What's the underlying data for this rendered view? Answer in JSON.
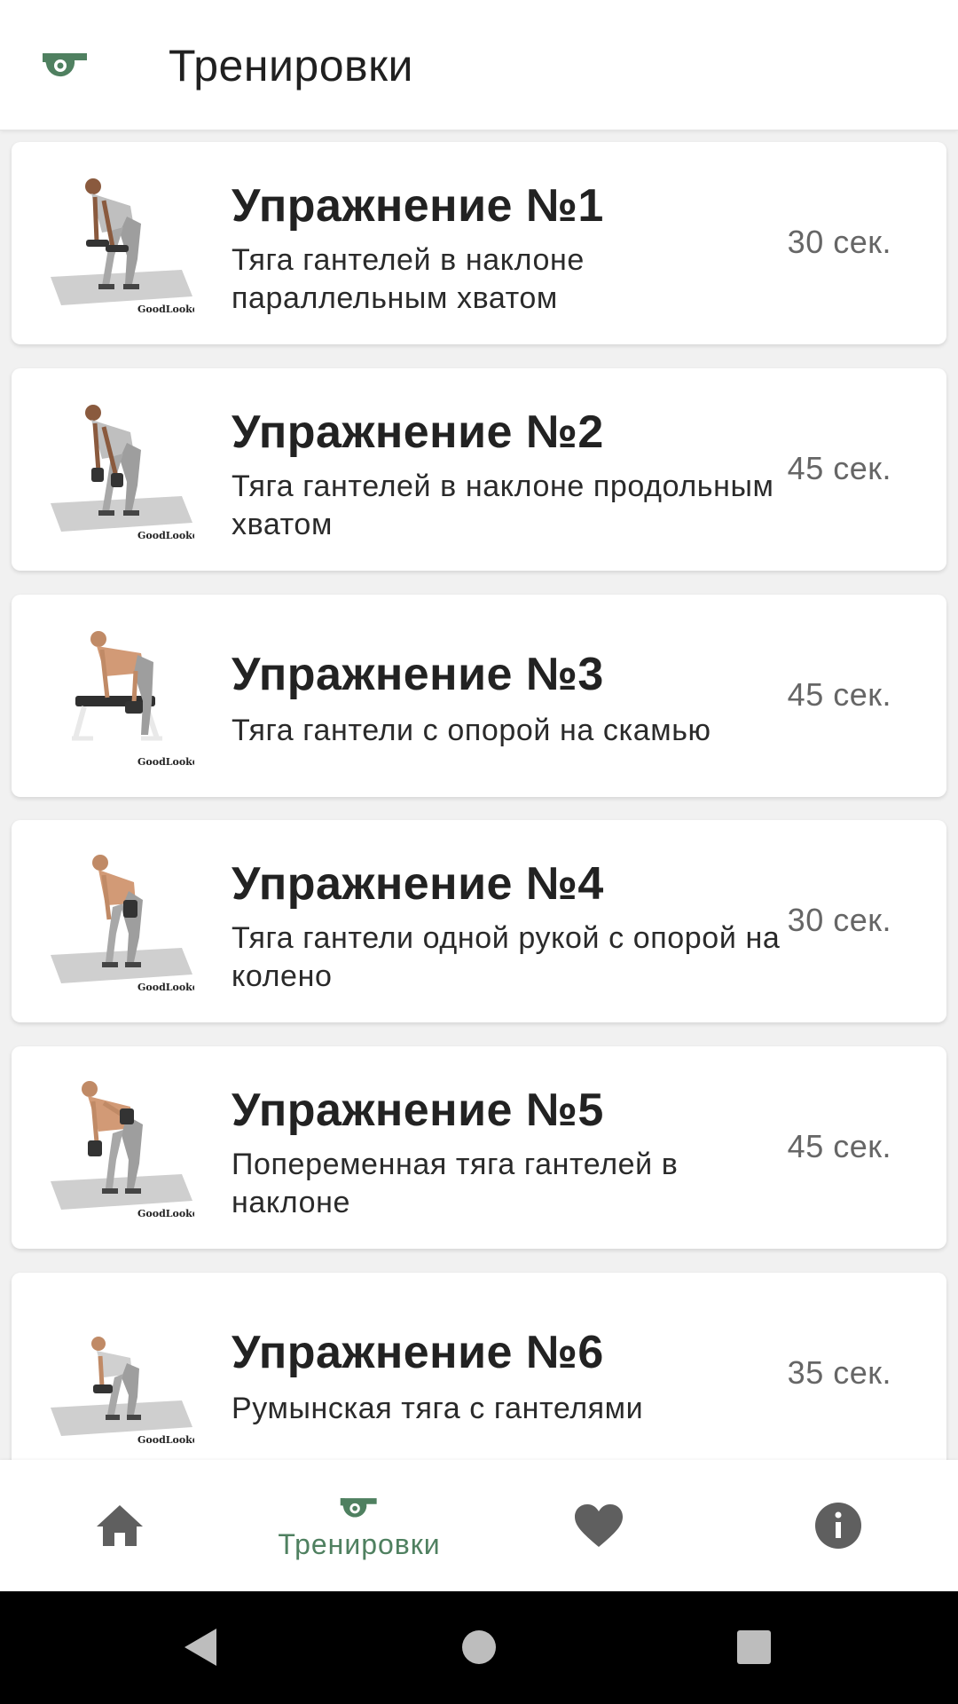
{
  "appbar": {
    "title": "Тренировки",
    "icon": "whistle-icon"
  },
  "exercises": [
    {
      "name": "Упражнение №1",
      "description": "Тяга гантелей в наклоне параллельным хватом",
      "duration": "30 сек.",
      "thumb_caption": "GoodLooker"
    },
    {
      "name": "Упражнение №2",
      "description": "Тяга гантелей в наклоне продольным хватом",
      "duration": "45 сек.",
      "thumb_caption": "GoodLooker"
    },
    {
      "name": "Упражнение №3",
      "description": "Тяга гантели с опорой на скамью",
      "duration": "45 сек.",
      "thumb_caption": "GoodLooker"
    },
    {
      "name": "Упражнение №4",
      "description": "Тяга гантели одной рукой с опорой на колено",
      "duration": "30 сек.",
      "thumb_caption": "GoodLooker"
    },
    {
      "name": "Упражнение №5",
      "description": "Попеременная тяга гантелей в наклоне",
      "duration": "45 сек.",
      "thumb_caption": "GoodLooker"
    },
    {
      "name": "Упражнение №6",
      "description": "Румынская тяга с гантелями",
      "duration": "35 сек.",
      "thumb_caption": "GoodLooker"
    }
  ],
  "bottom_nav": {
    "items": [
      {
        "icon": "home-icon",
        "label": ""
      },
      {
        "icon": "whistle-icon",
        "label": "Тренировки",
        "active": true
      },
      {
        "icon": "heart-icon",
        "label": ""
      },
      {
        "icon": "info-icon",
        "label": ""
      }
    ]
  },
  "system_nav": {
    "buttons": [
      "back-icon",
      "home-circle-icon",
      "recents-icon"
    ]
  },
  "colors": {
    "accent": "#4f8060",
    "icon_inactive": "#5f5f5f",
    "background": "#f1f1f1"
  }
}
